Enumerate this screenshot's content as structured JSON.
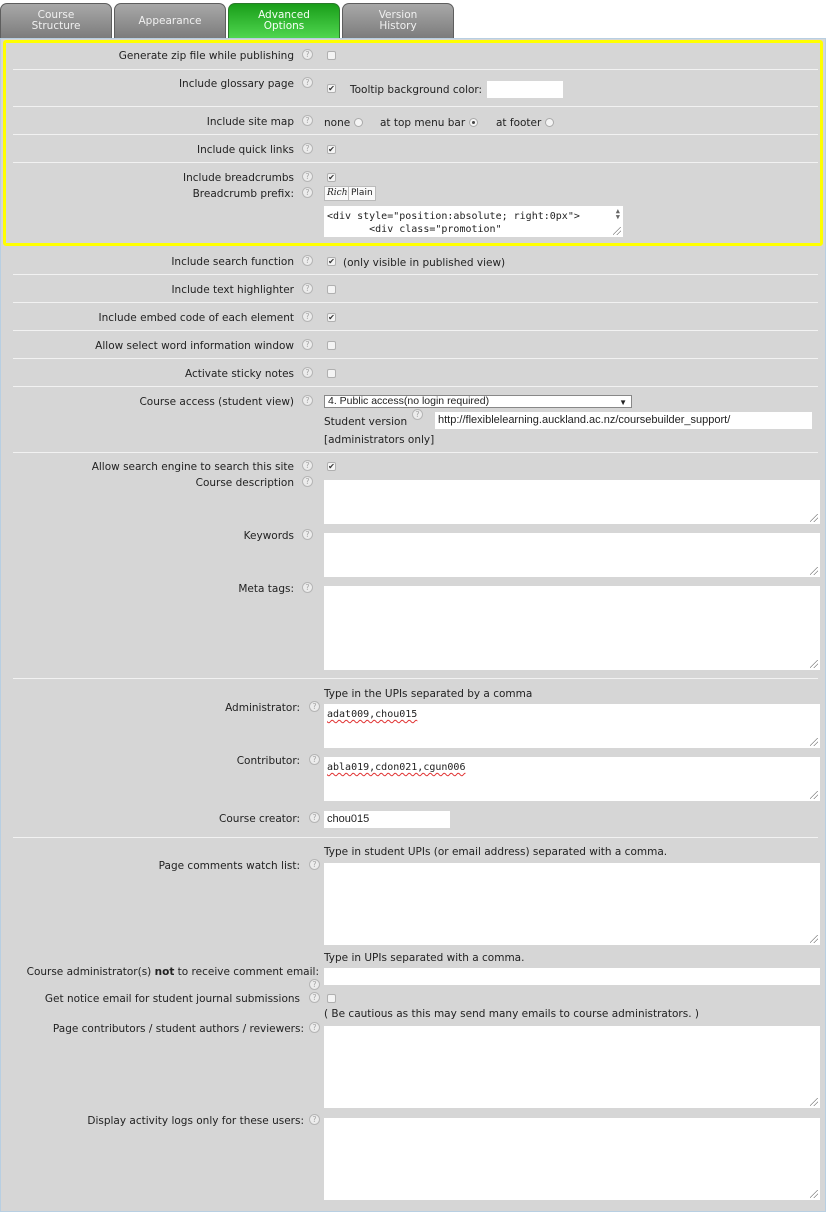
{
  "tabs": [
    {
      "label": "Course\nStructure",
      "active": false
    },
    {
      "label": "Appearance",
      "active": false
    },
    {
      "label": "Advanced\nOptions",
      "active": true
    },
    {
      "label": "Version\nHistory",
      "active": false
    }
  ],
  "colors": {
    "highlight": "#ffff00",
    "active_tab": "#2fb82f",
    "panel": "#d6d6d6"
  },
  "help_icon": "?",
  "checked_glyph": "✔",
  "options": {
    "zip": {
      "label": "Generate zip file while publishing",
      "checked": false
    },
    "glossary": {
      "label": "Include glossary page",
      "checked": true,
      "tooltip_label": "Tooltip background color:",
      "tooltip_value": ""
    },
    "sitemap": {
      "label": "Include site map",
      "choices": [
        "none",
        "at top menu bar",
        "at footer"
      ],
      "selected": "at top menu bar"
    },
    "quicklinks": {
      "label": "Include quick links",
      "checked": true
    },
    "breadcrumbs": {
      "label": "Include breadcrumbs",
      "checked": true
    },
    "breadcrumb_prefix": {
      "label": "Breadcrumb prefix:",
      "rich_label": "Rich",
      "plain_label": "Plain",
      "value": "<div style=\"position:absolute; right:0px\">\n       <div class=\"promotion\""
    },
    "search": {
      "label": "Include search function",
      "checked": true,
      "note": "(only visible in published view)"
    },
    "highlighter": {
      "label": "Include text highlighter",
      "checked": false
    },
    "embed": {
      "label": "Include embed code of each element",
      "checked": true
    },
    "word_info": {
      "label": "Allow select word information window",
      "checked": false
    },
    "sticky": {
      "label": "Activate sticky notes",
      "checked": false
    },
    "access": {
      "label": "Course access (student view)",
      "selected": "4. Public access(no login required)",
      "student_version_label": "Student version",
      "student_version_url": "http://flexiblelearning.auckland.ac.nz/coursebuilder_support/",
      "admin_note": "[administrators only]"
    },
    "search_engine": {
      "label": "Allow search engine to search this site",
      "checked": true
    },
    "course_description": {
      "label": "Course description",
      "value": ""
    },
    "keywords": {
      "label": "Keywords",
      "value": ""
    },
    "meta_tags": {
      "label": "Meta tags:",
      "value": ""
    }
  },
  "people": {
    "hint": "Type in the UPIs separated by a comma",
    "administrator": {
      "label": "Administrator:",
      "value": "adat009,chou015"
    },
    "contributor": {
      "label": "Contributor:",
      "value": "abla019,cdon021,cgun006"
    },
    "creator": {
      "label": "Course creator:",
      "value": "chou015"
    }
  },
  "comments": {
    "watch_hint": "Type in student UPIs (or email address) separated with a comma.",
    "watch_label": "Page comments watch list:",
    "watch_value": "",
    "no_email_hint": "Type in UPIs separated with a comma.",
    "no_email_label_pre": "Course administrator(s) ",
    "no_email_label_bold": "not",
    "no_email_label_post": " to receive comment email:",
    "no_email_value": "",
    "journal_label": "Get notice email for student journal submissions",
    "journal_checked": false,
    "journal_note": "( Be cautious as this may send many emails to course administrators. )",
    "contributors_label": "Page contributors / student authors / reviewers:",
    "contributors_value": "",
    "activity_label": "Display activity logs only for these users:",
    "activity_value": ""
  }
}
